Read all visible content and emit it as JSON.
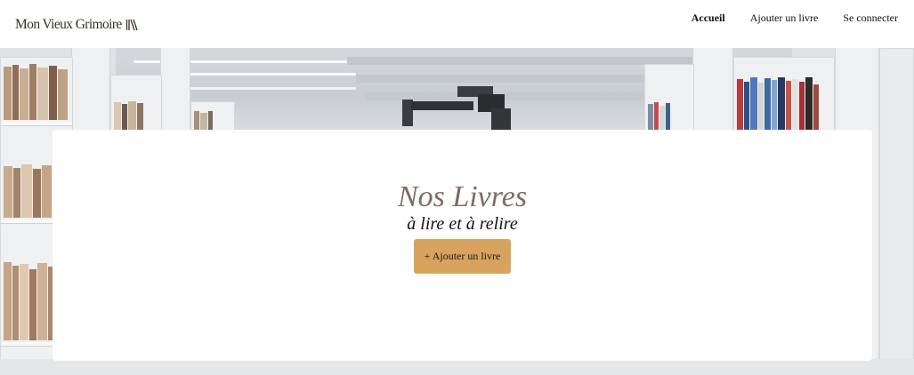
{
  "header": {
    "brand": {
      "name": "Mon Vieux Grimoire",
      "logo_icon": "book-spines-icon"
    },
    "nav": [
      {
        "label": "Accueil",
        "active": true
      },
      {
        "label": "Ajouter un livre",
        "active": false
      },
      {
        "label": "Se connecter",
        "active": false
      }
    ]
  },
  "hero": {
    "background": "library-shelves-photo",
    "title": "Nos Livres",
    "subtitle": "à lire et à relire",
    "add_button_label": "+ Ajouter un livre"
  },
  "colors": {
    "brand_text": "#3a2e28",
    "title": "#7d6b68",
    "button": "#d8a35f",
    "background": "#ffffff"
  }
}
